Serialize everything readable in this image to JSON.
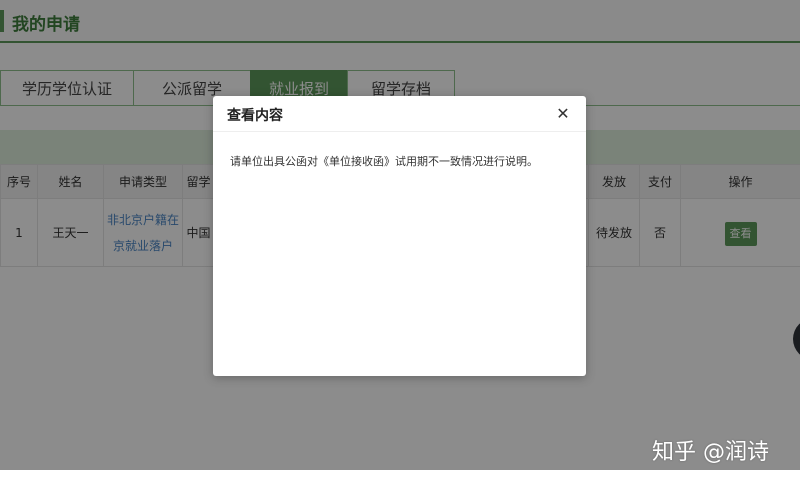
{
  "page": {
    "title": "我的申请"
  },
  "tabs": [
    {
      "label": "学历学位认证"
    },
    {
      "label": "公派留学"
    },
    {
      "label": "就业报到"
    },
    {
      "label": "留学存档"
    }
  ],
  "table": {
    "headers": [
      "序号",
      "姓名",
      "申请类型",
      "留学",
      "发放",
      "支付",
      "操作"
    ],
    "rows": [
      {
        "index": "1",
        "name": "王天一",
        "type_line1": "非北京户籍在",
        "type_line2": "京就业落户",
        "study_line1": "中国",
        "study_line2": "",
        "issue": "待发放",
        "paid": "否",
        "action": "查看"
      }
    ]
  },
  "modal": {
    "title": "查看内容",
    "close": "✕",
    "body": "请单位出具公函对《单位接收函》试用期不一致情况进行说明。"
  },
  "watermark": "知乎 @润诗",
  "colors": {
    "accent": "#5e9a5b",
    "link": "#4a86c5"
  }
}
